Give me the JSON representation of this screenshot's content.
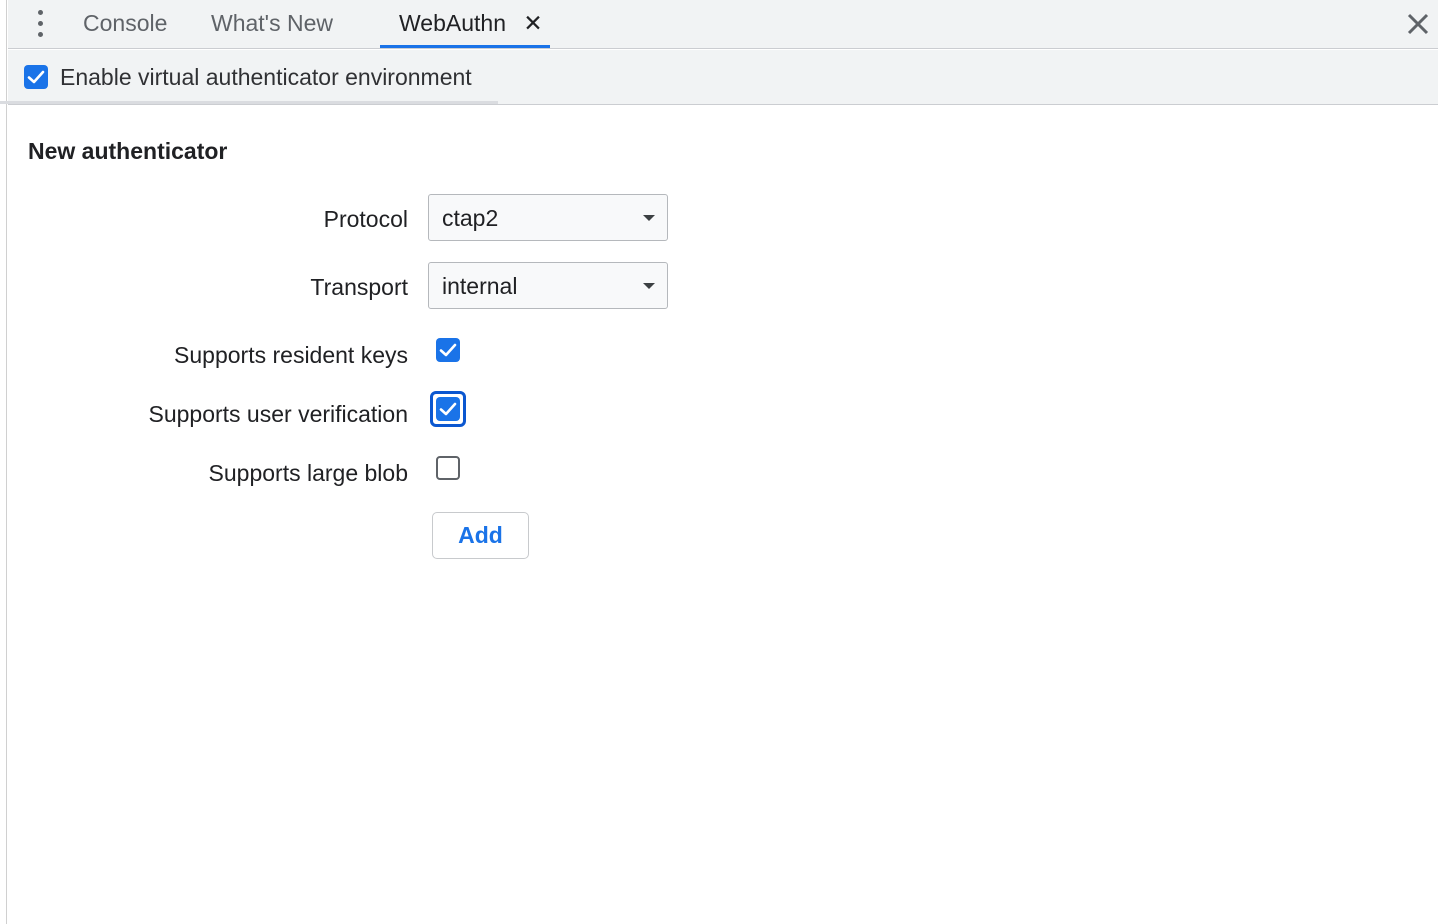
{
  "tabbar": {
    "menu_icon": "more-vertical-icon",
    "tabs": [
      {
        "label": "Console",
        "active": false
      },
      {
        "label": "What's New",
        "active": false
      },
      {
        "label": "WebAuthn",
        "active": true,
        "close_glyph": "✕"
      }
    ],
    "close_icon": "close-panel-icon"
  },
  "toolbar": {
    "enable_label": "Enable virtual authenticator environment",
    "enable_checked": true
  },
  "new_authenticator": {
    "title": "New authenticator",
    "protocol": {
      "label": "Protocol",
      "value": "ctap2"
    },
    "transport": {
      "label": "Transport",
      "value": "internal"
    },
    "resident_keys": {
      "label": "Supports resident keys",
      "checked": true
    },
    "user_verification": {
      "label": "Supports user verification",
      "checked": true,
      "focused": true
    },
    "large_blob": {
      "label": "Supports large blob",
      "checked": false
    },
    "add_label": "Add"
  },
  "colors": {
    "accent": "#1a73e8",
    "toolbar_bg": "#f1f3f4",
    "text": "#202124"
  }
}
